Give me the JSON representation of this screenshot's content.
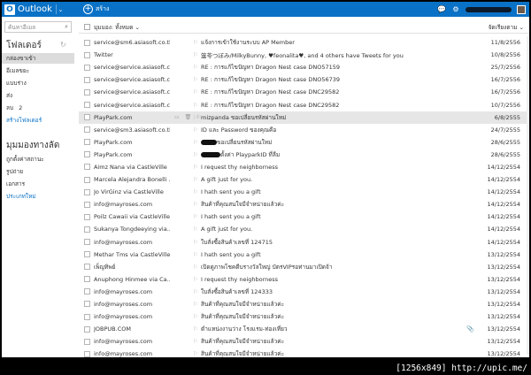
{
  "app": {
    "name": "Outlook",
    "logo_letter": "O"
  },
  "topbar": {
    "new_label": "สร้าง"
  },
  "sidebar": {
    "search_placeholder": "ค้นหาอีเมล",
    "folders_title": "โฟลเดอร์",
    "folders": [
      {
        "label": "กล่องขาเข้า",
        "count": "",
        "selected": true
      },
      {
        "label": "อีเมลขยะ",
        "count": ""
      },
      {
        "label": "แบบร่าง",
        "count": ""
      },
      {
        "label": "ส่ง",
        "count": ""
      },
      {
        "label": "ลบ",
        "count": "2"
      },
      {
        "label": "สร้างโฟลเดอร์",
        "link": true
      }
    ],
    "views_title": "มุมมองทางลัด",
    "views": [
      {
        "label": "ถูกตั้งค่าสถานะ"
      },
      {
        "label": "รูปถ่าย"
      },
      {
        "label": "เอกสาร"
      },
      {
        "label": "ประเภทใหม่",
        "link": true
      }
    ]
  },
  "list": {
    "filter_label": "มุมมอง: ทั้งหมด ⌄",
    "sort_label": "จัดเรียงตาม ⌄",
    "rows": [
      {
        "from": "service@sm6.asiasoft.co.th",
        "subject": "แจ้งการเข้าใช้งานระบบ AP Member",
        "date": "11/8/2556"
      },
      {
        "from": "Twitter",
        "subject": "筮苓つぼみ/MilkyBunny, ♥feonalita♥, and 4 others have Tweets for you",
        "date": "10/8/2556"
      },
      {
        "from": "service@service.asiasoft.c...",
        "subject": "RE : การแก้ไขปัญหา Dragon Nest case DNO57159",
        "date": "25/7/2556"
      },
      {
        "from": "service@service.asiasoft.c...",
        "subject": "RE : การแก้ไขปัญหา Dragon Nest case DNO56739",
        "date": "16/7/2556"
      },
      {
        "from": "service@service.asiasoft.c...",
        "subject": "RE : การแก้ไขปัญหา Dragon Nest case DNC29582",
        "date": "16/7/2556"
      },
      {
        "from": "service@service.asiasoft.c...",
        "subject": "RE : การแก้ไขปัญหา Dragon Nest case DNC29582",
        "date": "10/7/2556"
      },
      {
        "from": "PlayPark.com",
        "subject": "mizpanda ขอเปลี่ยนรหัสผ่านใหม่",
        "date": "6/8/2555",
        "selected": true,
        "actions": "▭ 🗑 ⚐"
      },
      {
        "from": "service@sm3.asiasoft.co.th",
        "subject": "ID และ Password ของคุณคือ",
        "date": "24/7/2555"
      },
      {
        "from": "PlayPark.com",
        "subject": "ขอเปลี่ยนรหัสผ่านใหม่",
        "date": "28/6/2555",
        "blot": 18
      },
      {
        "from": "PlayPark.com",
        "subject": "ตั้งค่า PlayparkID ที่ลืม",
        "date": "28/6/2555",
        "blot": 22
      },
      {
        "from": "Aimz Nana via CastleVille",
        "subject": "I request thy neighborness",
        "date": "14/12/2554"
      },
      {
        "from": "Marcela Alejandra Bonelli ...",
        "subject": "A gift just for you.",
        "date": "14/12/2554"
      },
      {
        "from": "Jo VirGinz via CastleVille",
        "subject": "I hath sent you a gift",
        "date": "14/12/2554"
      },
      {
        "from": "info@mayroses.com",
        "subject": "สินค้าที่คุณสนใจมีจำหน่ายแล้วค่ะ",
        "date": "14/12/2554"
      },
      {
        "from": "Poilz Cawaii via CastleVille",
        "subject": "I hath sent you a gift",
        "date": "14/12/2554"
      },
      {
        "from": "Sukanya Tongdeeying via...",
        "subject": "A gift just for you.",
        "date": "14/12/2554"
      },
      {
        "from": "info@mayroses.com",
        "subject": "ใบสั่งซื้อสินค้าเลขที่ 124715",
        "date": "14/12/2554"
      },
      {
        "from": "Methar Tms via CastleVille",
        "subject": "I hath sent you a gift",
        "date": "13/12/2554"
      },
      {
        "from": "เพ็ญทิพย์",
        "subject": "เปิดดูภาพโชคดีบรางวัลใหญ่ บัตรVIPรอท่านมาเปิดจ้า",
        "date": "13/12/2554"
      },
      {
        "from": "Anuphong Hinmee via Ca...",
        "subject": "I request thy neighborness",
        "date": "13/12/2554"
      },
      {
        "from": "info@mayroses.com",
        "subject": "ใบสั่งซื้อสินค้าเลขที่ 124333",
        "date": "13/12/2554"
      },
      {
        "from": "info@mayroses.com",
        "subject": "สินค้าที่คุณสนใจมีจำหน่ายแล้วค่ะ",
        "date": "13/12/2554"
      },
      {
        "from": "info@mayroses.com",
        "subject": "สินค้าที่คุณสนใจมีจำหน่ายแล้วค่ะ",
        "date": "13/12/2554"
      },
      {
        "from": "JOBPUB.COM",
        "subject": "ตำแหน่งงานว่าง โรงแรม-ท่องเที่ยว",
        "date": "13/12/2554",
        "attachment": true
      },
      {
        "from": "info@mayroses.com",
        "subject": "สินค้าที่คุณสนใจมีจำหน่ายแล้วค่ะ",
        "date": "13/12/2554"
      },
      {
        "from": "info@mayroses.com",
        "subject": "สินค้าที่คุณสนใจมีจำหน่ายแล้วค่ะ",
        "date": "13/12/2554"
      }
    ]
  },
  "watermark": "[1256x849] http://upic.me/"
}
